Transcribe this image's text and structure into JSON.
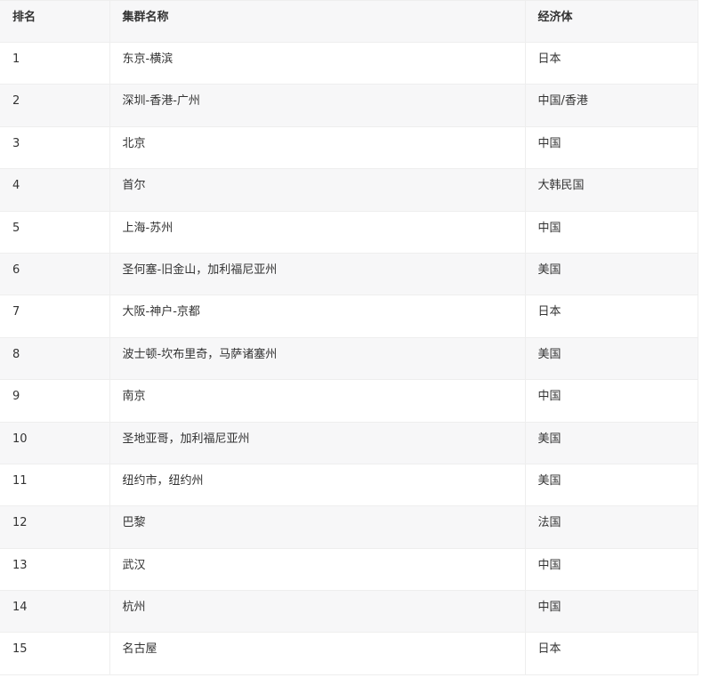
{
  "table": {
    "headers": {
      "rank": "排名",
      "name": "集群名称",
      "economy": "经济体"
    },
    "rows": [
      {
        "rank": "1",
        "name": "东京-横滨",
        "economy": "日本"
      },
      {
        "rank": "2",
        "name": "深圳-香港-广州",
        "economy": "中国/香港"
      },
      {
        "rank": "3",
        "name": "北京",
        "economy": "中国"
      },
      {
        "rank": "4",
        "name": "首尔",
        "economy": "大韩民国"
      },
      {
        "rank": "5",
        "name": "上海-苏州",
        "economy": "中国"
      },
      {
        "rank": "6",
        "name": "圣何塞-旧金山，加利福尼亚州",
        "economy": "美国"
      },
      {
        "rank": "7",
        "name": "大阪-神户-京都",
        "economy": "日本"
      },
      {
        "rank": "8",
        "name": "波士顿-坎布里奇，马萨诸塞州",
        "economy": "美国"
      },
      {
        "rank": "9",
        "name": "南京",
        "economy": "中国"
      },
      {
        "rank": "10",
        "name": "圣地亚哥，加利福尼亚州",
        "economy": "美国"
      },
      {
        "rank": "11",
        "name": "纽约市，纽约州",
        "economy": "美国"
      },
      {
        "rank": "12",
        "name": "巴黎",
        "economy": "法国"
      },
      {
        "rank": "13",
        "name": "武汉",
        "economy": "中国"
      },
      {
        "rank": "14",
        "name": "杭州",
        "economy": "中国"
      },
      {
        "rank": "15",
        "name": "名古屋",
        "economy": "日本"
      }
    ]
  }
}
